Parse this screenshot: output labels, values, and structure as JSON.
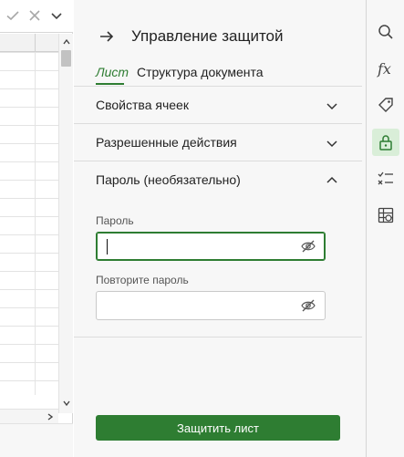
{
  "panel": {
    "title": "Управление защитой",
    "tabs": [
      {
        "label": "Лист",
        "active": true
      },
      {
        "label": "Структура документа",
        "active": false
      }
    ],
    "sections": [
      {
        "label": "Свойства ячеек",
        "expanded": false
      },
      {
        "label": "Разрешенные действия",
        "expanded": false
      },
      {
        "label": "Пароль (необязательно)",
        "expanded": true
      }
    ],
    "password": {
      "label": "Пароль",
      "value": "",
      "confirm_label": "Повторите пароль",
      "confirm_value": "",
      "toggle_icon": "eye-slash-icon"
    },
    "submit_label": "Защитить лист"
  },
  "toolbar": {
    "confirm_icon": "check-icon",
    "cancel_icon": "close-icon",
    "expand_icon": "chevron-down-icon"
  },
  "rail": {
    "items": [
      {
        "icon": "search-icon",
        "active": false
      },
      {
        "icon": "function-icon",
        "active": false
      },
      {
        "icon": "tag-icon",
        "active": false
      },
      {
        "icon": "lock-icon",
        "active": true
      },
      {
        "icon": "checklist-icon",
        "active": false
      },
      {
        "icon": "table-settings-icon",
        "active": false
      }
    ],
    "fx_glyph": "fx"
  },
  "colors": {
    "accent": "#2e7d32",
    "active_rail_bg": "#d9eed8",
    "panel_bg": "#f7f7f7"
  }
}
